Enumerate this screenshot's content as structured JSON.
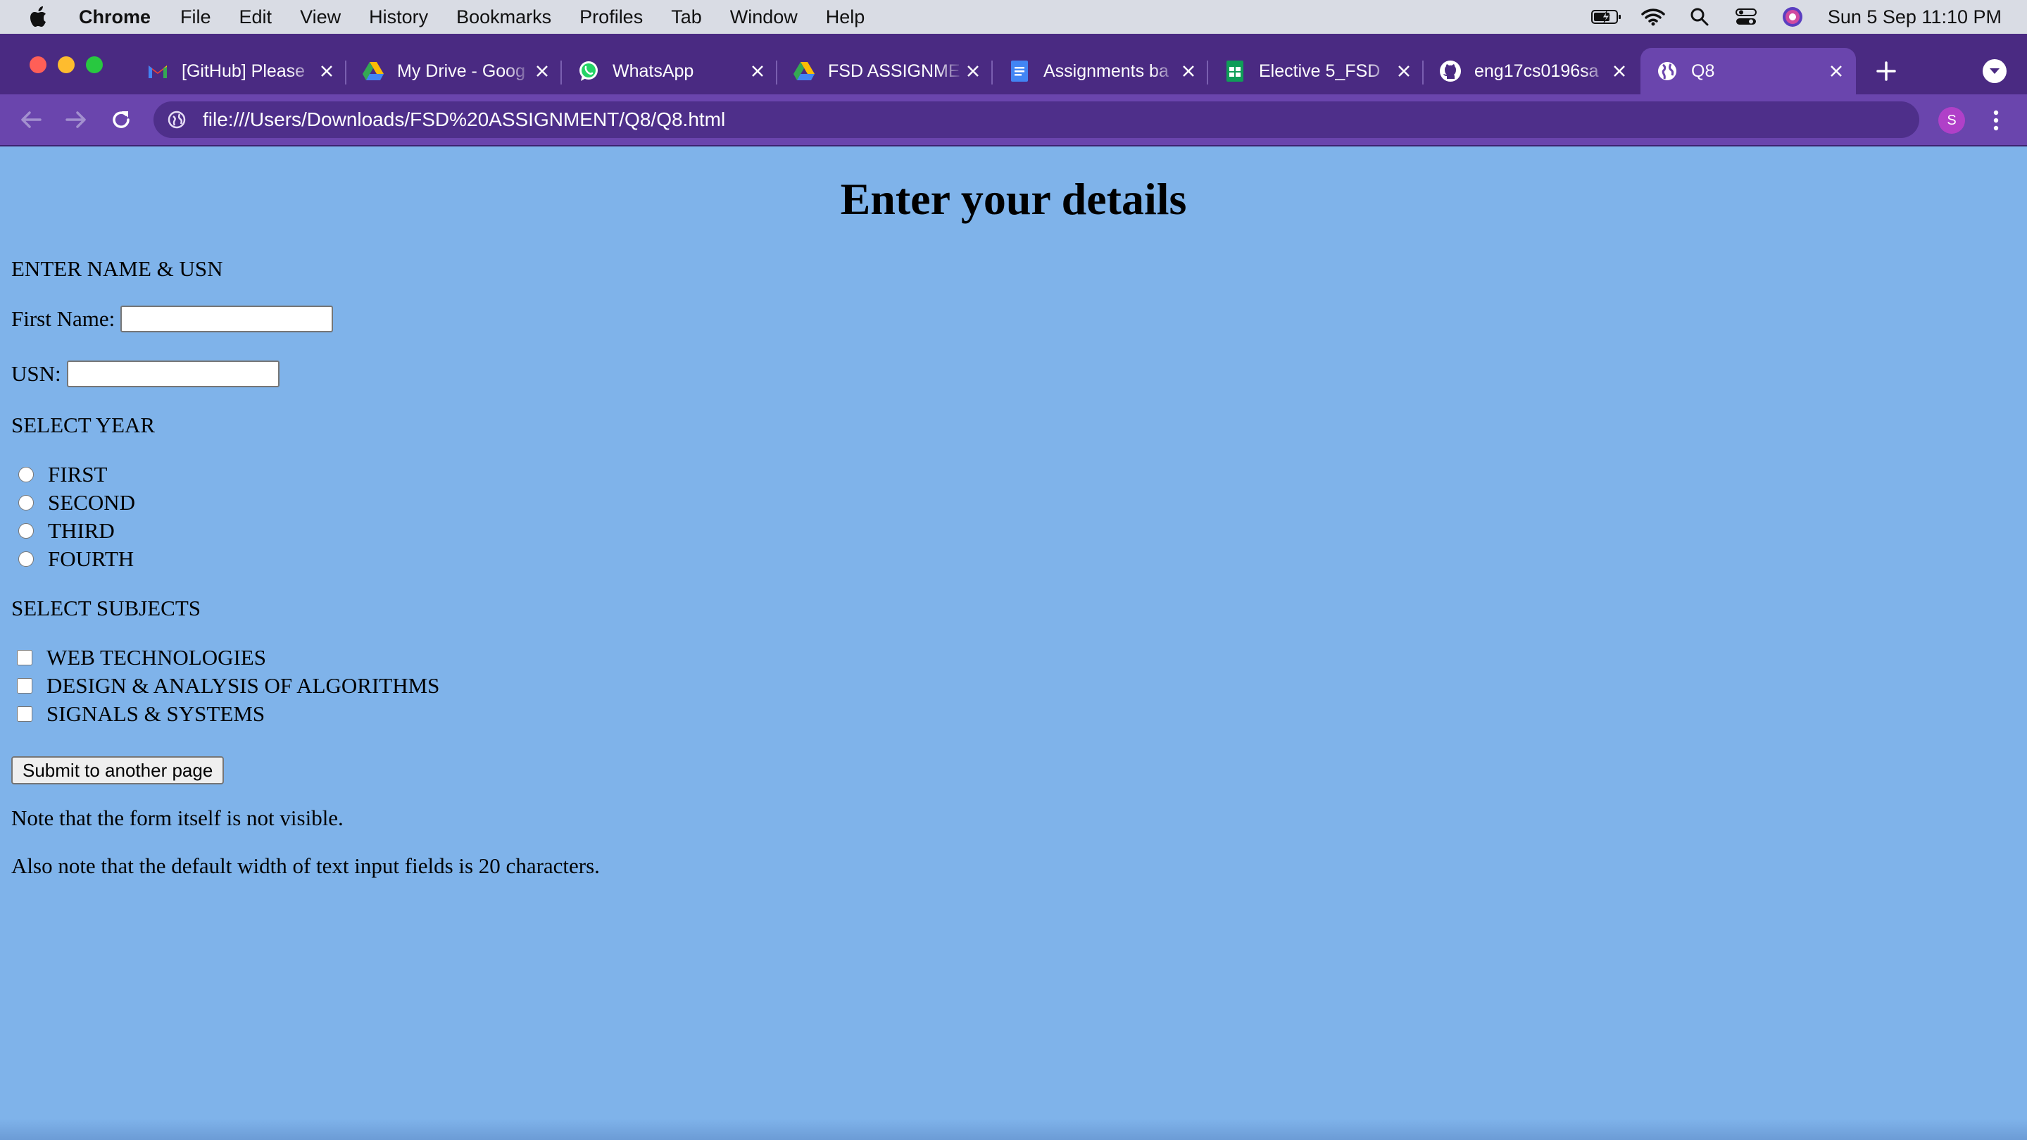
{
  "menubar": {
    "app_name": "Chrome",
    "items": [
      "File",
      "Edit",
      "View",
      "History",
      "Bookmarks",
      "Profiles",
      "Tab",
      "Window",
      "Help"
    ],
    "clock": "Sun 5 Sep  11:10 PM"
  },
  "tabs": [
    {
      "title": "[GitHub] Please",
      "icon": "gmail-icon"
    },
    {
      "title": "My Drive - Goog",
      "icon": "google-drive-icon"
    },
    {
      "title": "WhatsApp",
      "icon": "whatsapp-icon"
    },
    {
      "title": "FSD ASSIGNME",
      "icon": "google-drive-icon"
    },
    {
      "title": "Assignments ba",
      "icon": "google-docs-icon"
    },
    {
      "title": "Elective 5_FSD",
      "icon": "google-sheets-icon"
    },
    {
      "title": "eng17cs0196sa",
      "icon": "github-icon"
    },
    {
      "title": "Q8",
      "icon": "globe-icon",
      "active": true
    }
  ],
  "toolbar": {
    "url": "file:///Users/Downloads/FSD%20ASSIGNMENT/Q8/Q8.html",
    "profile_initial": "S"
  },
  "page": {
    "heading": "Enter your details",
    "name_section": "ENTER NAME & USN",
    "first_name_label": "First Name:",
    "first_name_value": "",
    "usn_label": "USN:",
    "usn_value": "",
    "year_section": "SELECT YEAR",
    "years": [
      "FIRST",
      "SECOND",
      "THIRD",
      "FOURTH"
    ],
    "subjects_section": "SELECT SUBJECTS",
    "subjects": [
      "WEB TECHNOLOGIES",
      "DESIGN & ANALYSIS OF ALGORITHMS",
      "SIGNALS & SYSTEMS"
    ],
    "submit_label": "Submit to another page",
    "note1": "Note that the form itself is not visible.",
    "note2": "Also note that the default width of text input fields is 20 characters."
  },
  "colors": {
    "page_background": "#7fb3ea",
    "tabstrip": "#4a2a82",
    "toolbar": "#6a45ad",
    "active_tab": "#6a45ad",
    "profile_avatar": "#b040c8"
  }
}
